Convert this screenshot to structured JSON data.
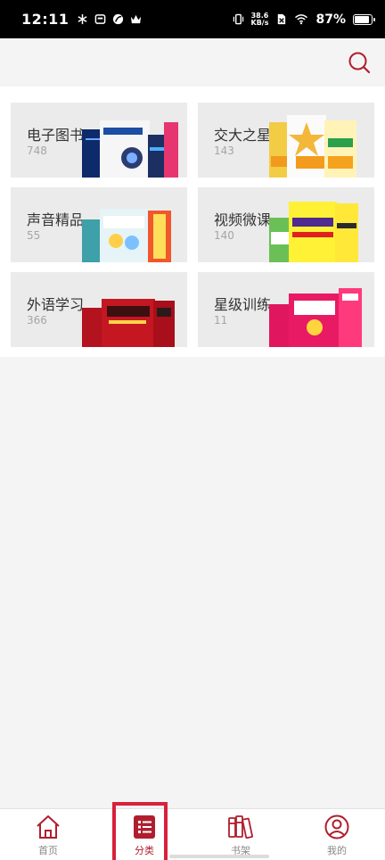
{
  "status_bar": {
    "time": "12:11",
    "net_speed_value": "38.6",
    "net_speed_unit": "KB/s",
    "battery_percent": "87%",
    "battery_level": 0.87
  },
  "header": {
    "search_icon": "search-icon"
  },
  "categories": [
    {
      "title": "电子图书",
      "count": "748"
    },
    {
      "title": "交大之星",
      "count": "143"
    },
    {
      "title": "声音精品",
      "count": "55"
    },
    {
      "title": "视频微课",
      "count": "140"
    },
    {
      "title": "外语学习",
      "count": "366"
    },
    {
      "title": "星级训练",
      "count": "11"
    }
  ],
  "bottom_nav": {
    "items": [
      {
        "label": "首页",
        "icon": "home-icon"
      },
      {
        "label": "分类",
        "icon": "category-icon"
      },
      {
        "label": "书架",
        "icon": "bookshelf-icon"
      },
      {
        "label": "我的",
        "icon": "profile-icon"
      }
    ],
    "active_index": 1
  },
  "colors": {
    "accent": "#b01e2e",
    "highlight": "#d8213a"
  }
}
